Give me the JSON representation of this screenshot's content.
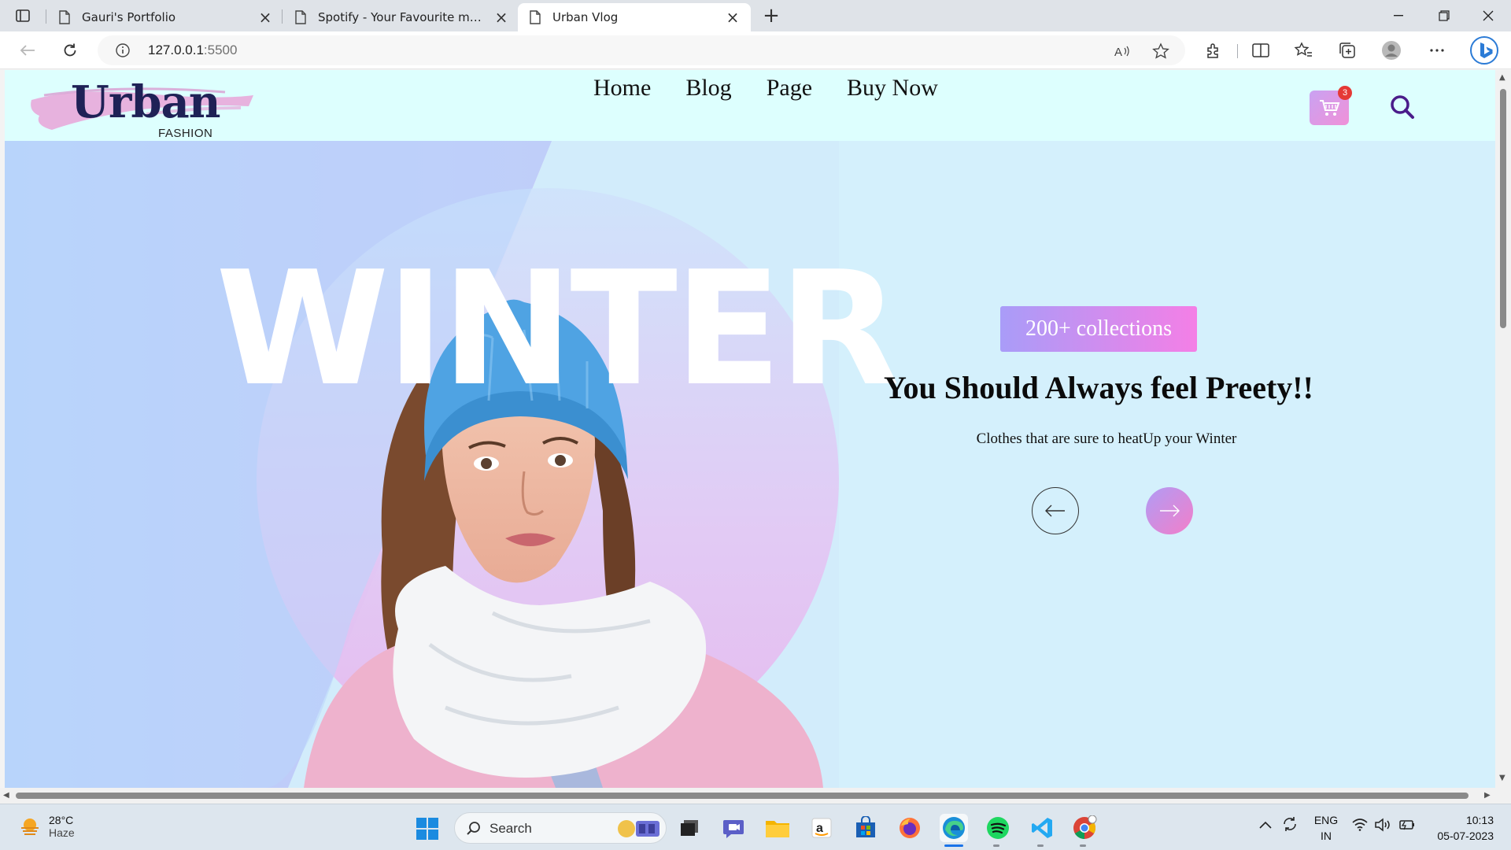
{
  "browser": {
    "tabs": [
      {
        "title": "Gauri's Portfolio",
        "active": false
      },
      {
        "title": "Spotify - Your Favourite music is here",
        "active": false
      },
      {
        "title": "Urban Vlog",
        "active": true
      }
    ],
    "url_host": "127.0.0.1",
    "url_port": ":5500"
  },
  "site": {
    "logo_text": "Urban",
    "logo_sub": "FASHION",
    "nav": [
      "Home",
      "Blog",
      "Page",
      "Buy Now"
    ],
    "cart_count": "3"
  },
  "hero": {
    "backdrop_word": "WINTER",
    "badge": "200+ collections",
    "headline": "You Should Always feel Preety!!",
    "subline": "Clothes that are sure to heatUp your Winter"
  },
  "taskbar": {
    "weather_temp": "28°C",
    "weather_desc": "Haze",
    "search_label": "Search",
    "lang_1": "ENG",
    "lang_2": "IN",
    "time": "10:13",
    "date": "05-07-2023"
  },
  "colors": {
    "accent_gradient_start": "#a99cf8",
    "accent_gradient_end": "#f47fe6",
    "header_bg": "#ddfffe",
    "hero_bg": "#d4f0fc",
    "logo_ink": "#1f2156"
  }
}
